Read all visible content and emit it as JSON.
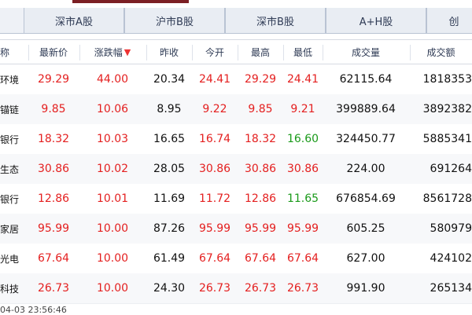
{
  "tabs": [
    {
      "label": "深市A股"
    },
    {
      "label": "沪市B股"
    },
    {
      "label": "深市B股"
    },
    {
      "label": "A+H股"
    },
    {
      "label": "创"
    }
  ],
  "columns": {
    "name": "称",
    "last": "最新价",
    "change_pct": "涨跌幅",
    "prev_close": "昨收",
    "open": "今开",
    "high": "最高",
    "low": "最低",
    "volume": "成交量",
    "amount": "成交额"
  },
  "rows": [
    {
      "name": "环境",
      "last": "29.29",
      "change_pct": "44.00",
      "prev_close": "20.34",
      "open": "24.41",
      "high": "29.29",
      "low": "24.41",
      "volume": "62115.64",
      "amount": "1818353"
    },
    {
      "name": "锚链",
      "last": "9.85",
      "change_pct": "10.06",
      "prev_close": "8.95",
      "open": "9.22",
      "high": "9.85",
      "low": "9.21",
      "volume": "399889.64",
      "amount": "3892382"
    },
    {
      "name": "银行",
      "last": "18.32",
      "change_pct": "10.03",
      "prev_close": "16.65",
      "open": "16.74",
      "high": "18.32",
      "low": "16.60",
      "volume": "324450.77",
      "amount": "5885341"
    },
    {
      "name": "生态",
      "last": "30.86",
      "change_pct": "10.02",
      "prev_close": "28.05",
      "open": "30.86",
      "high": "30.86",
      "low": "30.86",
      "volume": "224.00",
      "amount": "691264"
    },
    {
      "name": "银行",
      "last": "12.86",
      "change_pct": "10.01",
      "prev_close": "11.69",
      "open": "11.72",
      "high": "12.86",
      "low": "11.65",
      "volume": "676854.69",
      "amount": "8561728"
    },
    {
      "name": "家居",
      "last": "95.99",
      "change_pct": "10.00",
      "prev_close": "87.26",
      "open": "95.99",
      "high": "95.99",
      "low": "95.99",
      "volume": "605.25",
      "amount": "580979"
    },
    {
      "name": "光电",
      "last": "67.64",
      "change_pct": "10.00",
      "prev_close": "61.49",
      "open": "67.64",
      "high": "67.64",
      "low": "67.64",
      "volume": "627.00",
      "amount": "424102"
    },
    {
      "name": "科技",
      "last": "26.73",
      "change_pct": "10.00",
      "prev_close": "24.30",
      "open": "26.73",
      "high": "26.73",
      "low": "26.73",
      "volume": "991.90",
      "amount": "265134"
    }
  ],
  "colors": {
    "up": "#e41f1f",
    "down": "#1a9a1a",
    "highlight": "#fdeee6"
  },
  "footer": {
    "time": "04-03 23:56:46"
  }
}
